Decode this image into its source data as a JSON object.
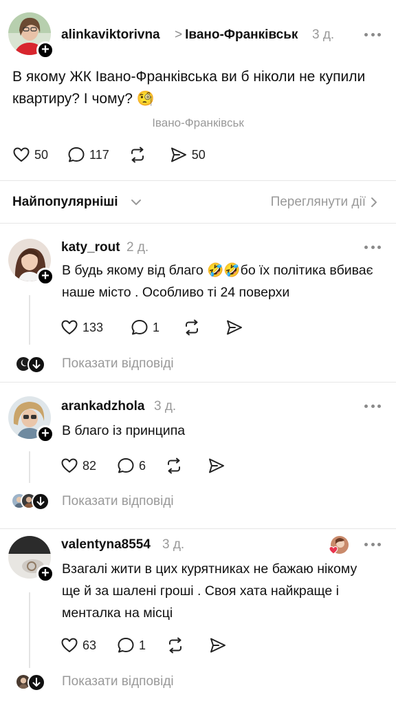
{
  "post": {
    "author": "alinkaviktorivna",
    "breadcrumb_separator": ">",
    "community": "Івано-Франківськ",
    "time": "3 д.",
    "text": "В якому ЖК Івано-Франківська ви б ніколи не купили квартиру? І чому? 🧐",
    "location_tag": "Івано-Франківськ",
    "likes": "50",
    "comments": "117",
    "shares": "50"
  },
  "sort": {
    "label": "Найпопулярніші",
    "view_activity": "Переглянути дії"
  },
  "comments": [
    {
      "author": "katy_rout",
      "time": "2 д.",
      "text": "В будь якому від благо 🤣🤣бо їх політика вбиває наше місто . Особливо ті 24 поверхи",
      "likes": "133",
      "replies": "1",
      "show_replies": "Показати відповіді"
    },
    {
      "author": "arankadzhola",
      "time": "3 д.",
      "text": "В благо із принципа",
      "likes": "82",
      "replies": "6",
      "show_replies": "Показати відповіді"
    },
    {
      "author": "valentyna8554",
      "time": "3 д.",
      "text": "Взагалі жити в цих курятниках не бажаю нікому ще й за шалені гроші . Своя хата найкраще і менталка на місці",
      "likes": "63",
      "replies": "1",
      "show_replies": "Показати відповіді"
    }
  ],
  "icons": {
    "like": "heart-icon",
    "comment": "comment-bubble-icon",
    "repost": "repost-icon",
    "share": "send-icon",
    "more": "more-dots-icon",
    "follow": "plus-icon",
    "expand": "chevron-down-icon",
    "open": "chevron-right-icon"
  },
  "colors": {
    "text": "#101010",
    "muted": "#999999",
    "divider": "#e6e6e6",
    "author_like_heart": "#e8344e"
  }
}
